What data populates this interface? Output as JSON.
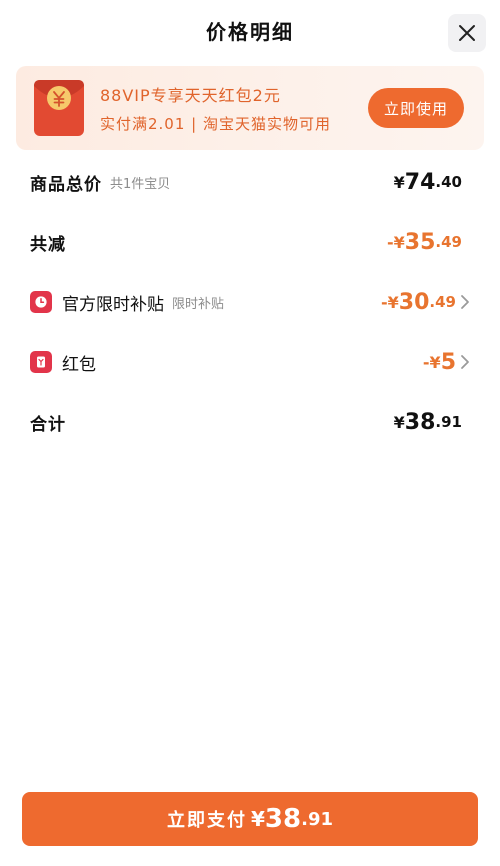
{
  "header": {
    "title": "价格明细",
    "close_icon": "close-icon"
  },
  "promo": {
    "icon": "red-envelope-icon",
    "line1": "88VIP专享天天红包2元",
    "line2": "实付满2.01 | 淘宝天猫实物可用",
    "button_label": "立即使用",
    "colors": {
      "accent": "#ee6a2f",
      "text": "#e0642c",
      "background": "#fdebe1"
    }
  },
  "rows": {
    "total": {
      "label": "商品总价",
      "sub": "共1件宝贝",
      "prefix": "¥",
      "int": "74",
      "dec": ".40"
    },
    "reduced": {
      "label": "共减",
      "prefix": "-¥",
      "int": "35",
      "dec": ".49"
    },
    "subsidy": {
      "icon": "clock-icon",
      "label": "官方限时补贴",
      "sub": "限时补贴",
      "prefix": "-¥",
      "int": "30",
      "dec": ".49"
    },
    "redpacket": {
      "icon": "red-packet-icon",
      "label": "红包",
      "prefix": "-¥",
      "int": "5",
      "dec": ""
    },
    "sum": {
      "label": "合计",
      "prefix": "¥",
      "int": "38",
      "dec": ".91"
    }
  },
  "pay": {
    "label": "立即支付",
    "prefix": "¥",
    "int": "38",
    "dec": ".91"
  },
  "colors": {
    "orange": "#e8742f",
    "button": "#ee6a2f",
    "icon_red": "#e2354a"
  }
}
